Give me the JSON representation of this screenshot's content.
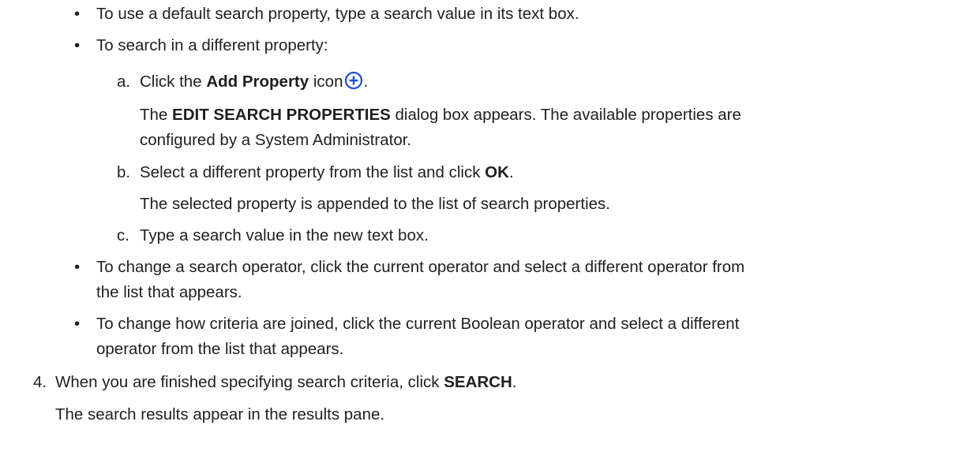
{
  "doc": {
    "bullet1": "To use a default search property, type a search value in its text box.",
    "bullet2": "To search in a different property:",
    "sub_a": {
      "marker": "a.",
      "pre": "Click the ",
      "bold": "Add Property",
      "post": " icon",
      "tail": ".",
      "icon": "add-property-icon"
    },
    "sub_a_note": {
      "pre": "The ",
      "bold": "EDIT SEARCH PROPERTIES",
      "line1_post": " dialog box appears. The available properties are",
      "line2": "configured by a System Administrator."
    },
    "sub_b": {
      "marker": "b.",
      "pre": "Select a different property from the list and click ",
      "bold": "OK",
      "post": "."
    },
    "sub_b_note": "The selected property is appended to the list of search properties.",
    "sub_c": {
      "marker": "c.",
      "text": "Type a search value in the new text box."
    },
    "bullet3": {
      "line1": "To change a search operator, click the current operator and select a different operator from",
      "line2": "the list that appears."
    },
    "bullet4": {
      "line1": "To change how criteria are joined, click the current Boolean operator and select a different",
      "line2": "operator from the list that appears."
    },
    "step4": {
      "marker": "4.",
      "pre": "When you are finished specifying search criteria, click ",
      "bold": "SEARCH",
      "post": "."
    },
    "step4_note": "The search results appear in the results pane.",
    "bullet_glyph": "•",
    "icon_color": "#1a4fd6"
  }
}
